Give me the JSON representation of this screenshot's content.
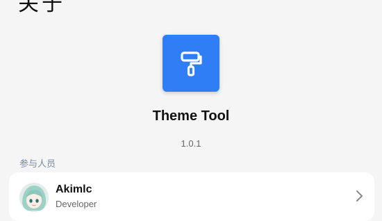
{
  "header": {
    "title": "关于"
  },
  "app": {
    "icon": "paint-roller-icon",
    "name": "Theme Tool",
    "version": "1.0.1",
    "accent_color": "#2f7ef6"
  },
  "contributors": {
    "section_label": "参与人员",
    "items": [
      {
        "name": "Akimlc",
        "role": "Developer",
        "avatar": "avatar-icon",
        "chevron": "chevron-right-icon"
      }
    ]
  }
}
